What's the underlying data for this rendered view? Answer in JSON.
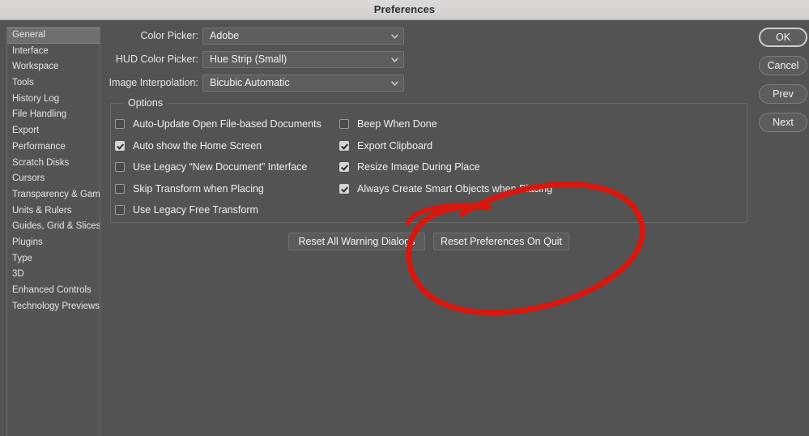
{
  "window": {
    "title": "Preferences"
  },
  "sidebar": {
    "selected_index": 0,
    "items": [
      {
        "label": "General"
      },
      {
        "label": "Interface"
      },
      {
        "label": "Workspace"
      },
      {
        "label": "Tools"
      },
      {
        "label": "History Log"
      },
      {
        "label": "File Handling"
      },
      {
        "label": "Export"
      },
      {
        "label": "Performance"
      },
      {
        "label": "Scratch Disks"
      },
      {
        "label": "Cursors"
      },
      {
        "label": "Transparency & Gamut"
      },
      {
        "label": "Units & Rulers"
      },
      {
        "label": "Guides, Grid & Slices"
      },
      {
        "label": "Plugins"
      },
      {
        "label": "Type"
      },
      {
        "label": "3D"
      },
      {
        "label": "Enhanced Controls"
      },
      {
        "label": "Technology Previews"
      }
    ]
  },
  "form": {
    "rows": [
      {
        "label": "Color Picker:",
        "value": "Adobe"
      },
      {
        "label": "HUD Color Picker:",
        "value": "Hue Strip (Small)"
      },
      {
        "label": "Image Interpolation:",
        "value": "Bicubic Automatic"
      }
    ]
  },
  "options": {
    "legend": "Options",
    "left_column": [
      {
        "label": "Auto-Update Open File-based Documents",
        "checked": false
      },
      {
        "label": "Auto show the Home Screen",
        "checked": true
      },
      {
        "label": "Use Legacy “New Document” Interface",
        "checked": false
      },
      {
        "label": "Skip Transform when Placing",
        "checked": false
      },
      {
        "label": "Use Legacy Free Transform",
        "checked": false
      }
    ],
    "right_column": [
      {
        "label": "Beep When Done",
        "checked": false
      },
      {
        "label": "Export Clipboard",
        "checked": true
      },
      {
        "label": "Resize Image During Place",
        "checked": true
      },
      {
        "label": "Always Create Smart Objects when Placing",
        "checked": true
      }
    ]
  },
  "reset_buttons": [
    {
      "label": "Reset All Warning Dialogs"
    },
    {
      "label": "Reset Preferences On Quit"
    }
  ],
  "action_buttons": [
    {
      "label": "OK",
      "primary": true
    },
    {
      "label": "Cancel",
      "primary": false
    },
    {
      "label": "Prev",
      "primary": false
    },
    {
      "label": "Next",
      "primary": false
    }
  ],
  "annotation": {
    "shape": "hand-drawn-ellipse",
    "color": "#D8180F",
    "targets": "Reset Preferences On Quit"
  },
  "colors": {
    "background": "#535353",
    "titlebar": "#d7d3d1",
    "annotation_red": "#D8180F",
    "selected_row": "#6f6f6f"
  }
}
